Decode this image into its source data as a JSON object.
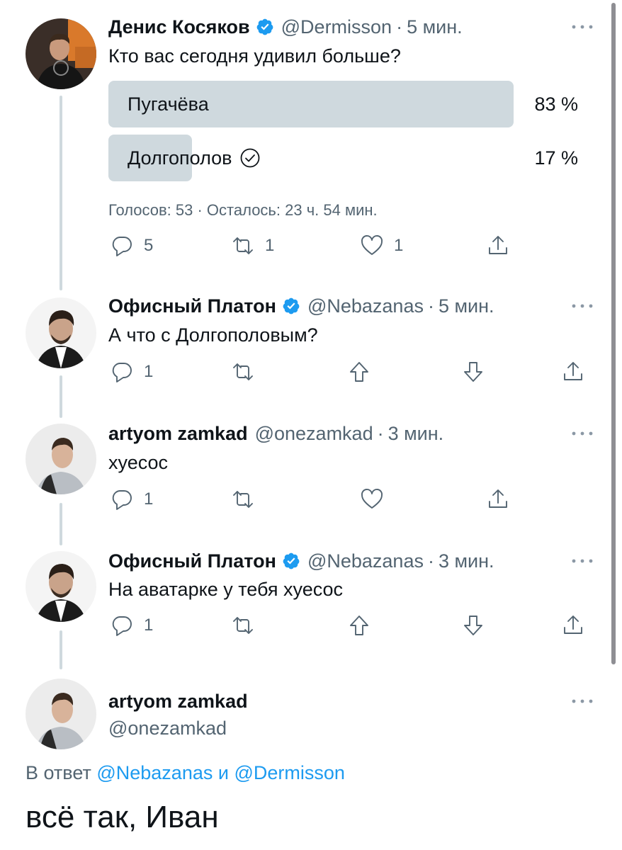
{
  "colors": {
    "accent": "#1d9bf0",
    "muted": "#536471",
    "poll_bar": "#cfd9de",
    "thread_line": "#cfd9de"
  },
  "tweet1": {
    "name": "Денис Косяков",
    "handle": "@Dermisson",
    "sep": "·",
    "time": "5 мин.",
    "text": "Кто вас сегодня удивил больше?",
    "poll": {
      "options": [
        {
          "label": "Пугачёва",
          "percent_text": "83 %",
          "percent": 83,
          "selected": false
        },
        {
          "label": "Долгополов",
          "percent_text": "17 %",
          "percent": 17,
          "selected": true
        }
      ],
      "meta": "Голосов: 53 · Осталось: 23 ч. 54 мин."
    },
    "actions": {
      "replies": "5",
      "retweets": "1",
      "likes": "1"
    }
  },
  "tweet2": {
    "name": "Офисный Платон",
    "handle": "@Nebazanas",
    "sep": "·",
    "time": "5 мин.",
    "text": "А что с Долгополовым?",
    "actions": {
      "replies": "1"
    }
  },
  "tweet3": {
    "name": "artyom zamkad",
    "handle": "@onezamkad",
    "sep": "·",
    "time": "3 мин.",
    "text": "хуесос",
    "actions": {
      "replies": "1"
    }
  },
  "tweet4": {
    "name": "Офисный Платон",
    "handle": "@Nebazanas",
    "sep": "·",
    "time": "3 мин.",
    "text": "На аватарке у тебя хуесос",
    "actions": {
      "replies": "1"
    }
  },
  "main_tweet": {
    "name": "artyom zamkad",
    "handle": "@onezamkad",
    "reply_prefix": "В ответ",
    "reply_user1": "@Nebazanas",
    "reply_and": "и",
    "reply_user2": "@Dermisson",
    "text": "всё так, Иван"
  }
}
